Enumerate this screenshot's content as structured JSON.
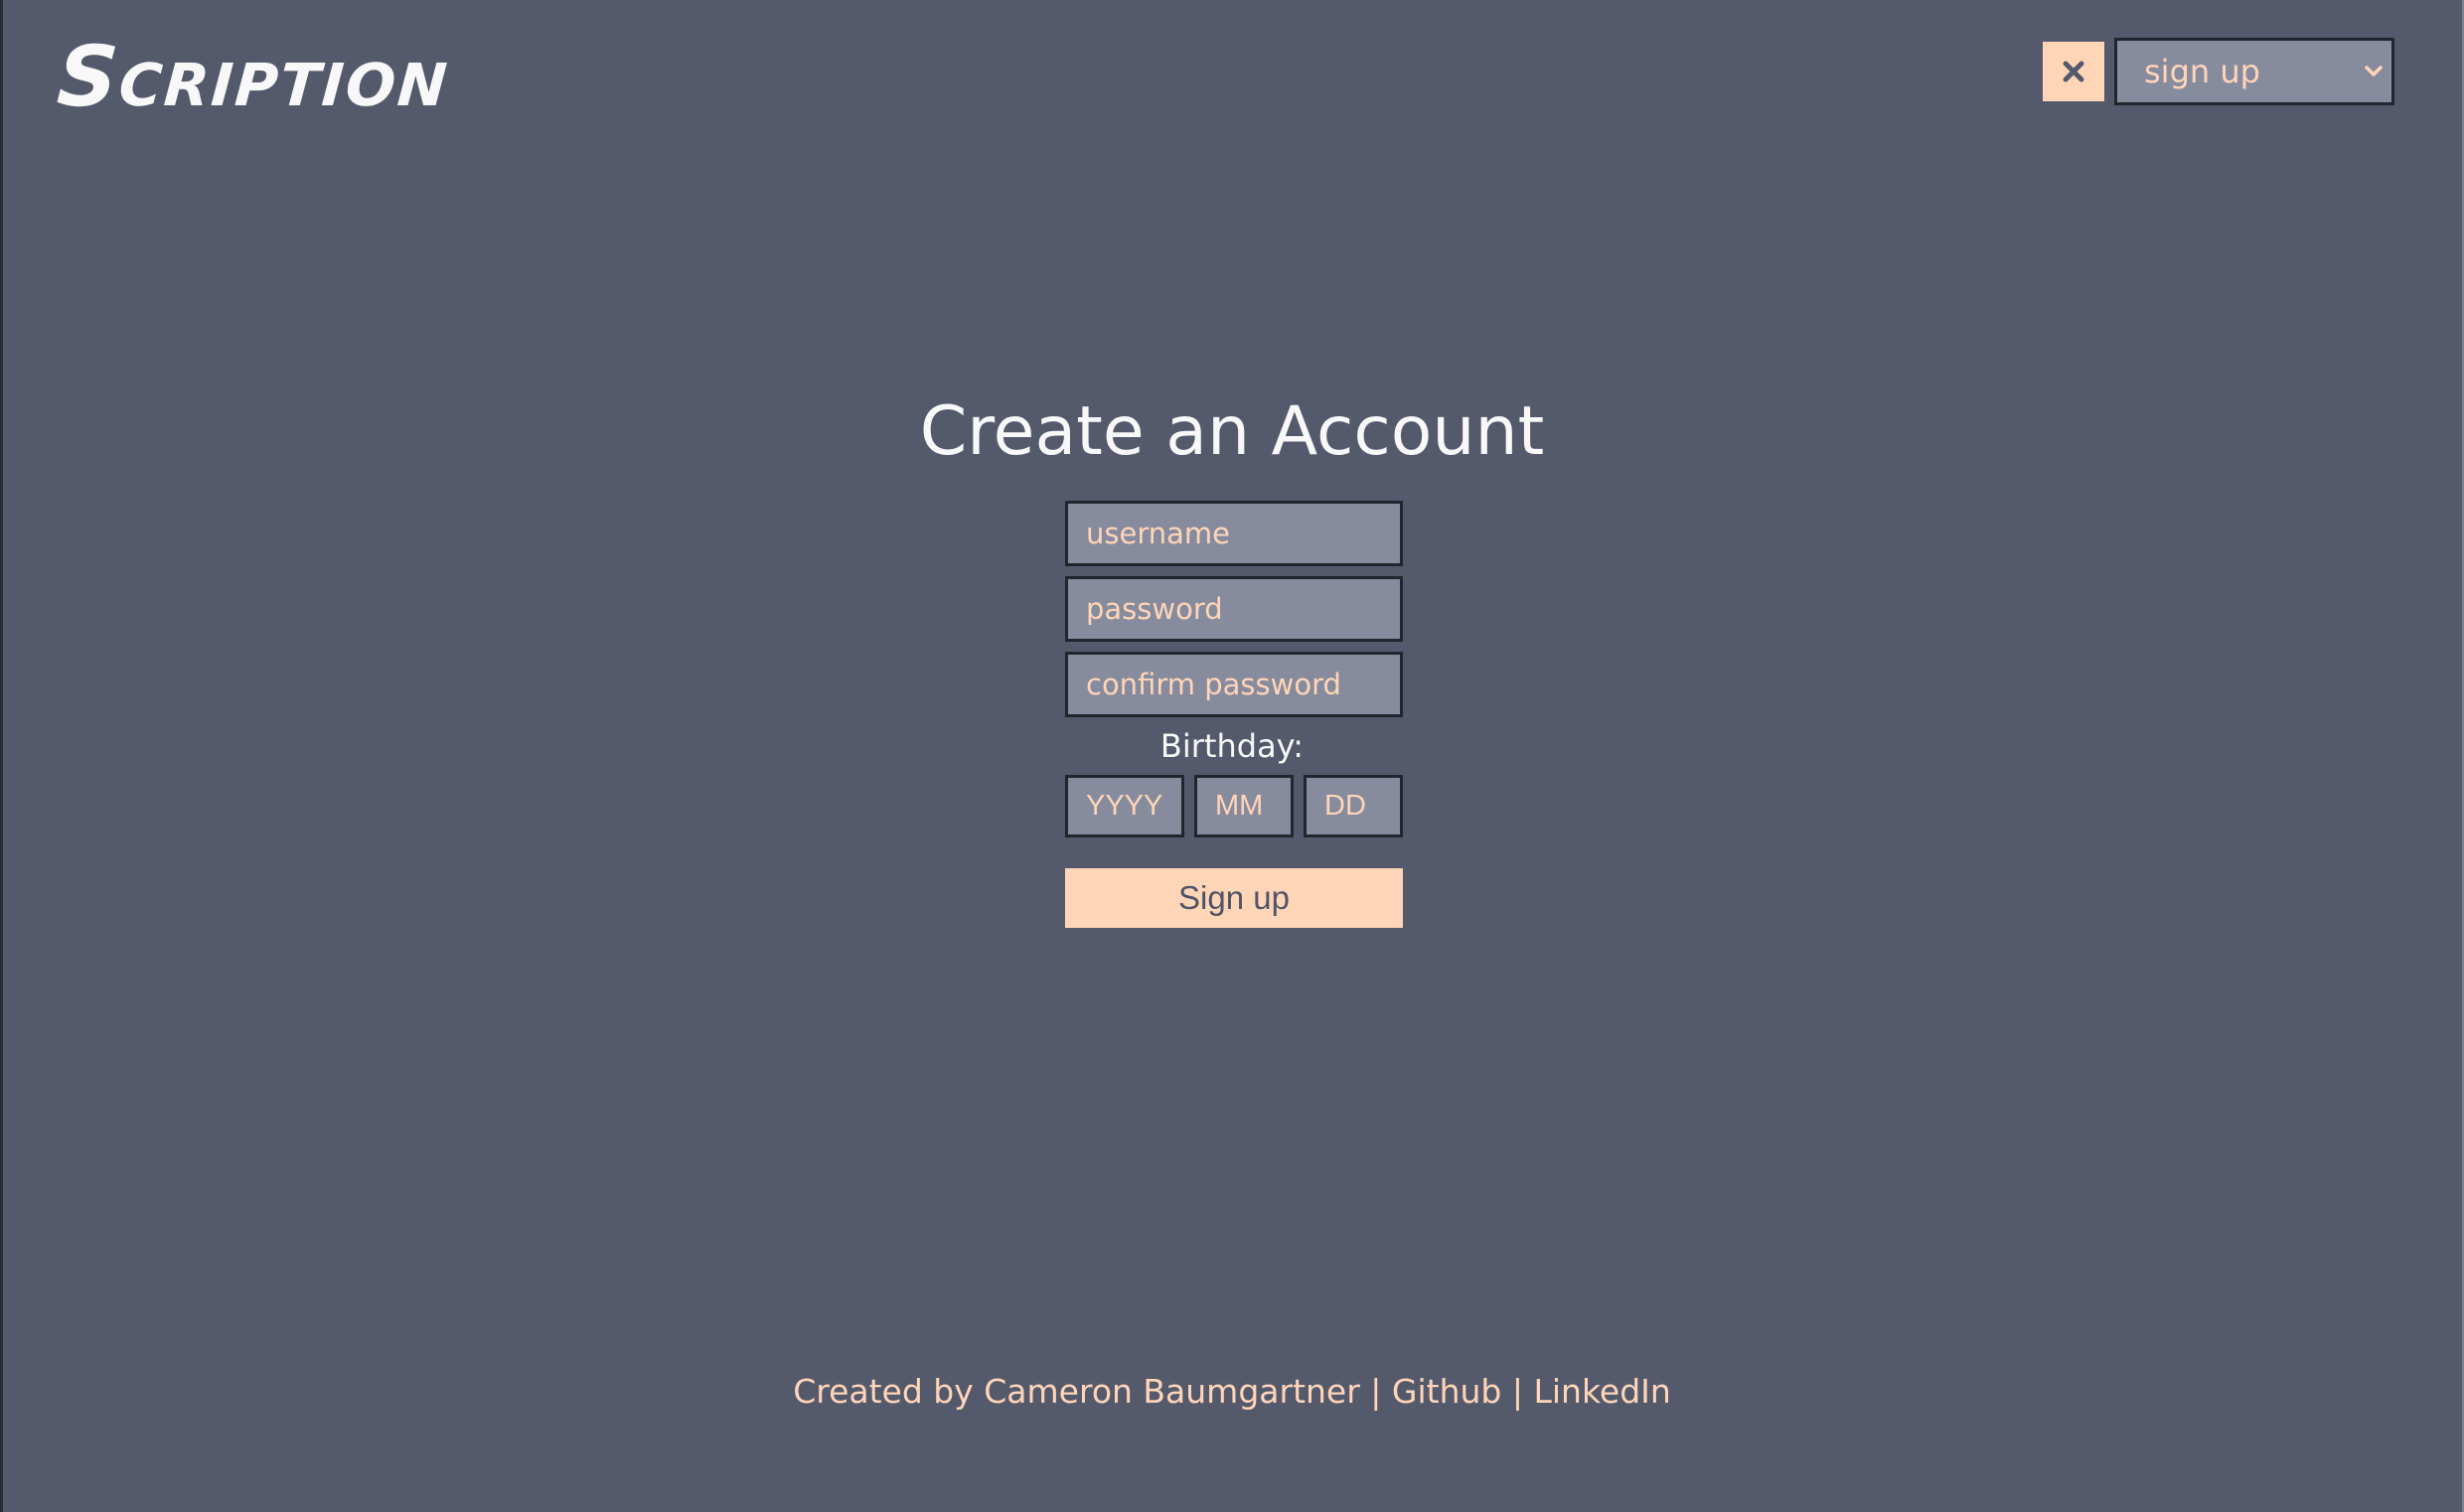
{
  "app": {
    "logo_text": "Scription"
  },
  "header": {
    "close_icon": "close-icon",
    "mode_select": {
      "selected": "sign up",
      "icon": "chevron-down-icon"
    }
  },
  "form": {
    "title": "Create an Account",
    "username_placeholder": "username",
    "username_value": "",
    "password_placeholder": "password",
    "password_value": "",
    "confirm_password_placeholder": "confirm password",
    "confirm_password_value": "",
    "birthday_label": "Birthday:",
    "year_placeholder": "YYYY",
    "month_placeholder": "MM",
    "day_placeholder": "DD",
    "submit_label": "Sign up"
  },
  "footer": {
    "credit_text": "Created by Cameron Baumgartner",
    "separator": " | ",
    "github_label": "Github",
    "linkedin_label": "LinkedIn"
  },
  "colors": {
    "background": "#545a6c",
    "input_background": "#878b9e",
    "accent": "#ffd5b8",
    "input_border": "#22252d",
    "heading_text": "#f8f8f8"
  }
}
